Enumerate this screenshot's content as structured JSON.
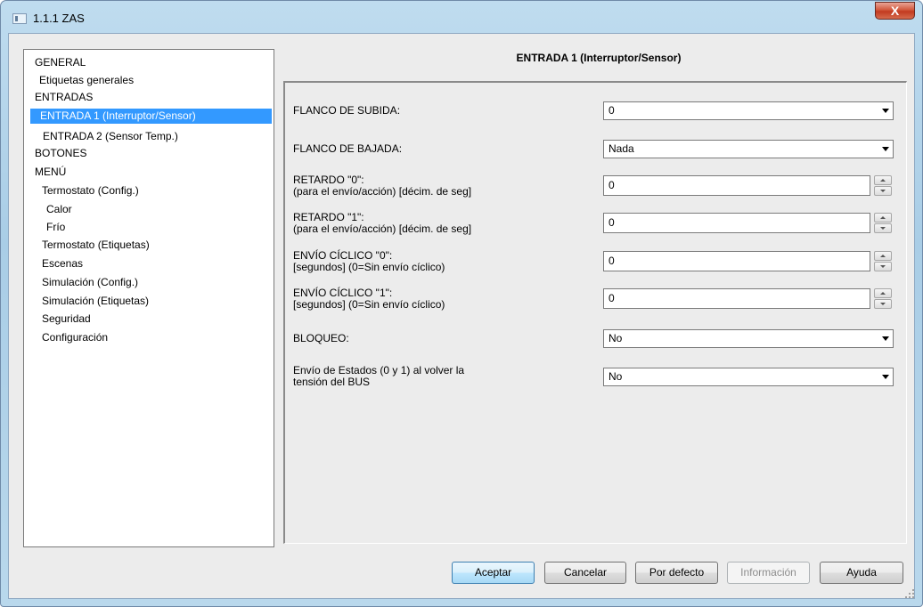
{
  "window": {
    "title": "1.1.1 ZAS",
    "close_label": "X"
  },
  "tree": {
    "items": [
      {
        "label": "GENERAL",
        "selected": false
      },
      {
        "label": "Etiquetas generales",
        "selected": false
      },
      {
        "label": "ENTRADAS",
        "selected": false
      },
      {
        "label": "ENTRADA 1 (Interruptor/Sensor)",
        "selected": true
      },
      {
        "label": "ENTRADA 2 (Sensor Temp.)",
        "selected": false
      },
      {
        "label": "BOTONES",
        "selected": false
      },
      {
        "label": "MENÚ",
        "selected": false
      },
      {
        "label": "Termostato (Config.)",
        "selected": false
      },
      {
        "label": "Calor",
        "selected": false
      },
      {
        "label": "Frío",
        "selected": false
      },
      {
        "label": "Termostato (Etiquetas)",
        "selected": false
      },
      {
        "label": "Escenas",
        "selected": false
      },
      {
        "label": "Simulación (Config.)",
        "selected": false
      },
      {
        "label": "Simulación (Etiquetas)",
        "selected": false
      },
      {
        "label": "Seguridad",
        "selected": false
      },
      {
        "label": "Configuración",
        "selected": false
      }
    ]
  },
  "panel": {
    "title": "ENTRADA 1 (Interruptor/Sensor)",
    "params": [
      {
        "label": "FLANCO DE SUBIDA:",
        "sublabel": "",
        "type": "select",
        "value": "0"
      },
      {
        "label": "FLANCO DE BAJADA:",
        "sublabel": "",
        "type": "select",
        "value": "Nada"
      },
      {
        "label": "RETARDO \"0\":",
        "sublabel": "(para el envío/acción) [décim. de seg]",
        "type": "number",
        "value": "0"
      },
      {
        "label": "RETARDO \"1\":",
        "sublabel": "(para el envío/acción) [décim. de seg]",
        "type": "number",
        "value": "0"
      },
      {
        "label": "ENVÍO CÍCLICO \"0\":",
        "sublabel": "[segundos] (0=Sin envío cíclico)",
        "type": "number",
        "value": "0"
      },
      {
        "label": "ENVÍO CÍCLICO \"1\":",
        "sublabel": "[segundos] (0=Sin envío cíclico)",
        "type": "number",
        "value": "0"
      },
      {
        "label": "BLOQUEO:",
        "sublabel": "",
        "type": "select",
        "value": "No"
      },
      {
        "label": "Envío de Estados (0 y 1) al volver la",
        "sublabel": "tensión del BUS",
        "type": "select",
        "value": "No"
      }
    ]
  },
  "buttons": {
    "accept": "Aceptar",
    "cancel": "Cancelar",
    "default": "Por defecto",
    "info": "Información",
    "help": "Ayuda"
  }
}
